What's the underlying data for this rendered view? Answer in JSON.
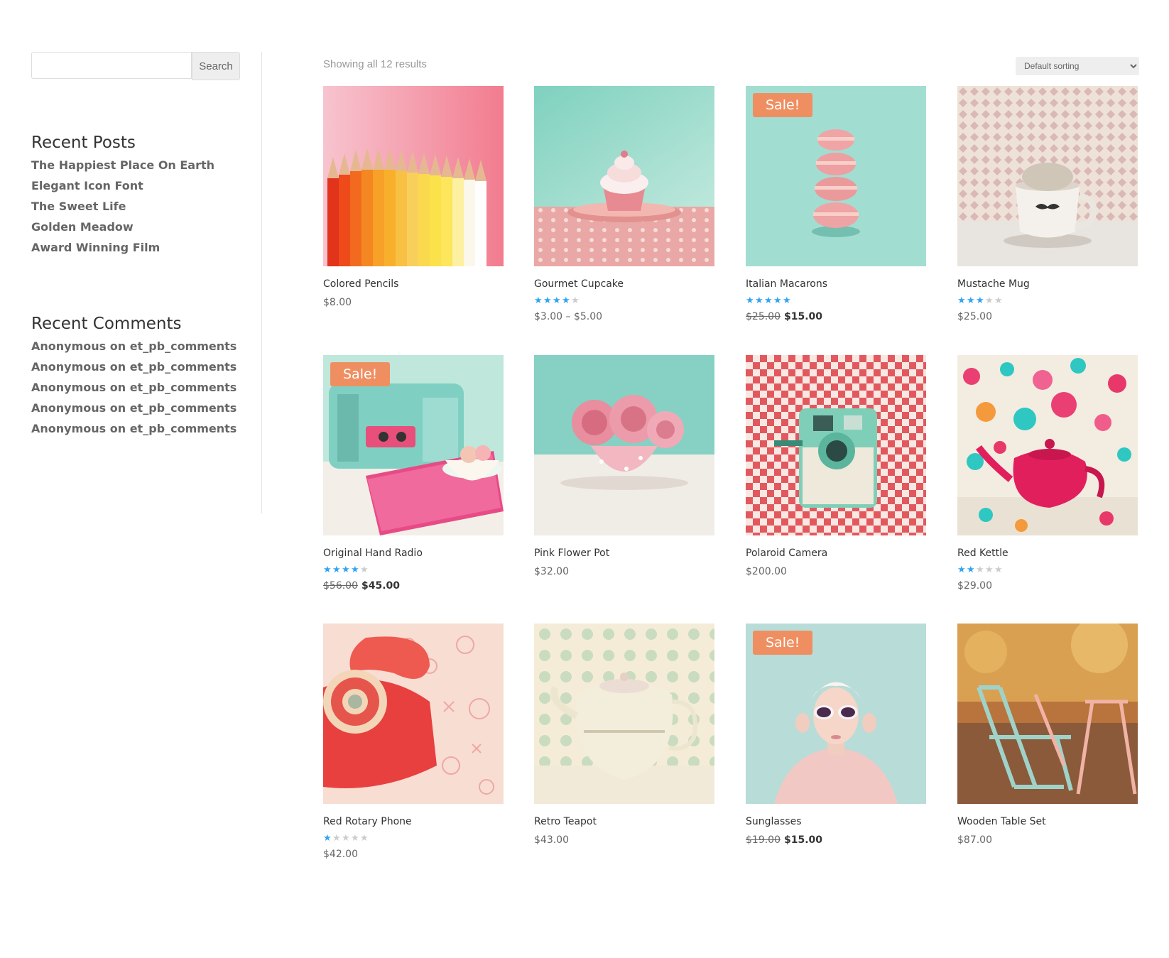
{
  "search": {
    "placeholder": "",
    "button_label": "Search"
  },
  "recent_posts": {
    "title": "Recent Posts",
    "items": [
      "The Happiest Place On Earth",
      "Elegant Icon Font",
      "The Sweet Life",
      "Golden Meadow",
      "Award Winning Film"
    ]
  },
  "recent_comments": {
    "title": "Recent Comments",
    "items": [
      "Anonymous on et_pb_comments",
      "Anonymous on et_pb_comments",
      "Anonymous on et_pb_comments",
      "Anonymous on et_pb_comments",
      "Anonymous on et_pb_comments"
    ]
  },
  "shop": {
    "result_count": "Showing all 12 results",
    "sorting_selected": "Default sorting",
    "colors": {
      "accent": "#2ea3f2",
      "sale_badge": "#ef8f61"
    },
    "products": [
      {
        "name": "Colored Pencils",
        "price": "$8.00",
        "rating": null,
        "sale": false,
        "image": "colored-pencils-image"
      },
      {
        "name": "Gourmet Cupcake",
        "price": "$3.00 – $5.00",
        "rating": 4,
        "sale": false,
        "image": "cupcake-image"
      },
      {
        "name": "Italian Macarons",
        "old_price": "$25.00",
        "price": "$15.00",
        "rating": 5,
        "sale": true,
        "sale_label": "Sale!",
        "image": "macarons-image"
      },
      {
        "name": "Mustache Mug",
        "price": "$25.00",
        "rating": 3,
        "sale": false,
        "image": "mug-image"
      },
      {
        "name": "Original Hand Radio",
        "old_price": "$56.00",
        "price": "$45.00",
        "rating": 4,
        "sale": true,
        "sale_label": "Sale!",
        "image": "radio-image"
      },
      {
        "name": "Pink Flower Pot",
        "price": "$32.00",
        "rating": null,
        "sale": false,
        "image": "flower-pot-image"
      },
      {
        "name": "Polaroid Camera",
        "price": "$200.00",
        "rating": null,
        "sale": false,
        "image": "camera-image"
      },
      {
        "name": "Red Kettle",
        "price": "$29.00",
        "rating": 2,
        "sale": false,
        "image": "kettle-image"
      },
      {
        "name": "Red Rotary Phone",
        "price": "$42.00",
        "rating": 1,
        "sale": false,
        "image": "phone-image"
      },
      {
        "name": "Retro Teapot",
        "price": "$43.00",
        "rating": null,
        "sale": false,
        "image": "teapot-image"
      },
      {
        "name": "Sunglasses",
        "old_price": "$19.00",
        "price": "$15.00",
        "rating": null,
        "sale": true,
        "sale_label": "Sale!",
        "image": "sunglasses-image"
      },
      {
        "name": "Wooden Table Set",
        "price": "$87.00",
        "rating": null,
        "sale": false,
        "image": "table-set-image"
      }
    ]
  }
}
